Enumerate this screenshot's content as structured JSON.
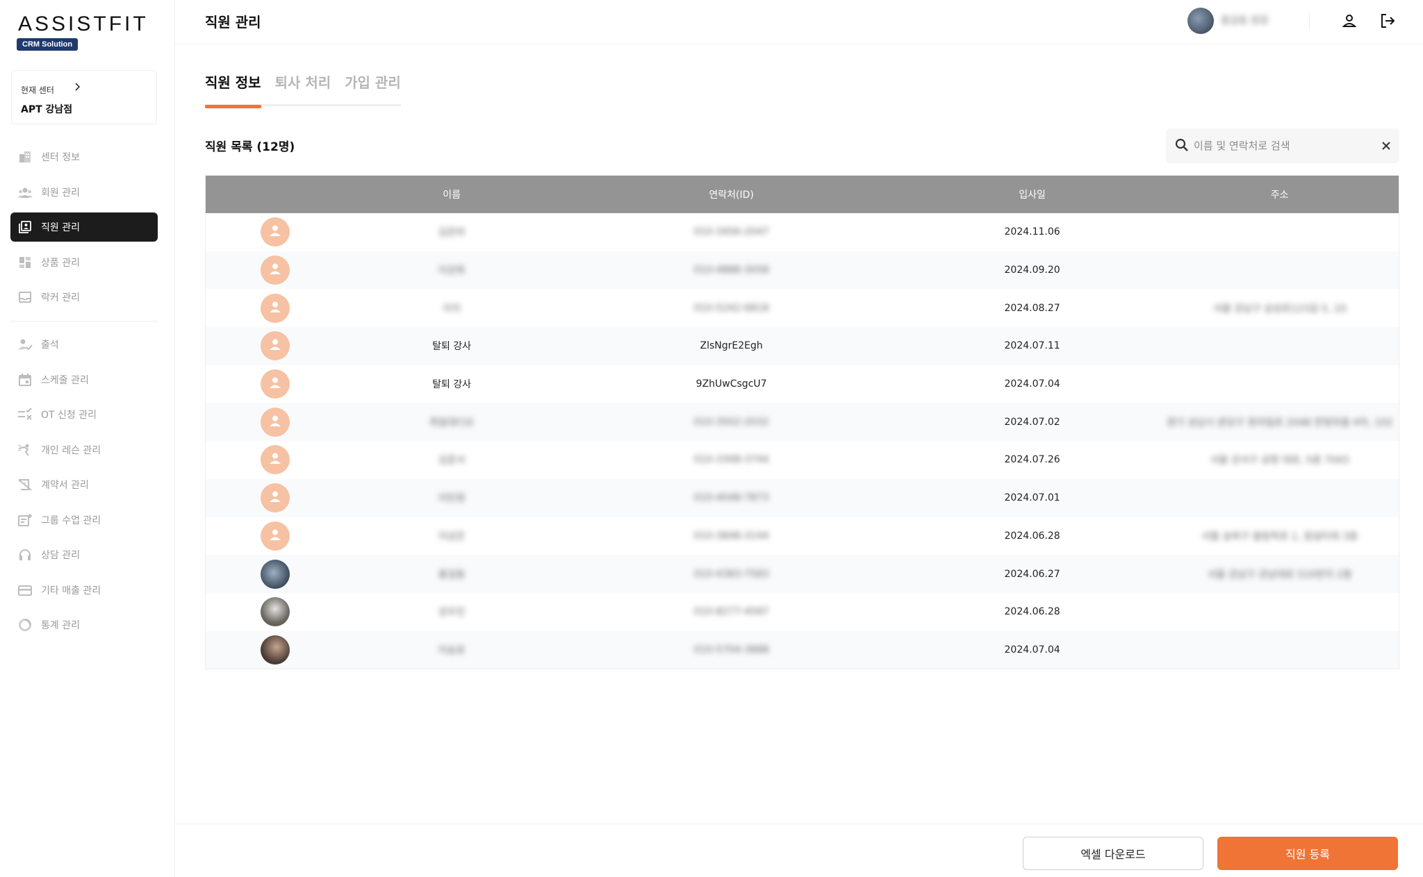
{
  "brand": {
    "logo": "ASSISTFIT",
    "badge": "CRM Solution"
  },
  "center": {
    "label": "현재 센터",
    "name": "APT 강남점"
  },
  "sidebar": {
    "items": [
      {
        "label": "센터 정보",
        "icon": "building-icon"
      },
      {
        "label": "회원 관리",
        "icon": "members-icon"
      },
      {
        "label": "직원 관리",
        "icon": "staff-icon",
        "active": true
      },
      {
        "label": "상품 관리",
        "icon": "grid-icon"
      },
      {
        "label": "락커 관리",
        "icon": "locker-icon"
      },
      {
        "label": "출석",
        "icon": "attendance-icon"
      },
      {
        "label": "스케줄 관리",
        "icon": "calendar-icon"
      },
      {
        "label": "OT 신청 관리",
        "icon": "ot-icon"
      },
      {
        "label": "개인 레슨 관리",
        "icon": "lesson-icon"
      },
      {
        "label": "계약서 관리",
        "icon": "contract-icon"
      },
      {
        "label": "그룹 수업 관리",
        "icon": "group-class-icon"
      },
      {
        "label": "상담 관리",
        "icon": "headset-icon"
      },
      {
        "label": "기타 매출 관리",
        "icon": "card-icon"
      },
      {
        "label": "통계 관리",
        "icon": "stats-icon"
      }
    ]
  },
  "header": {
    "title": "직원 관리",
    "user_name": "홍길동 원장"
  },
  "tabs": [
    {
      "label": "직원 정보",
      "active": true
    },
    {
      "label": "퇴사 처리"
    },
    {
      "label": "가입 관리"
    }
  ],
  "list": {
    "title": "직원 목록 (12명)"
  },
  "search": {
    "placeholder": "이름 및 연락처로 검색"
  },
  "table": {
    "columns": [
      "이름",
      "연락처(ID)",
      "입사일",
      "주소"
    ],
    "rows": [
      {
        "name": "김은비",
        "phone": "010-3456-2047",
        "date": "2024.11.06",
        "address": "",
        "avatar": "default",
        "blurred": true
      },
      {
        "name": "이강희",
        "phone": "010-4888-3058",
        "date": "2024.09.20",
        "address": "",
        "avatar": "default",
        "blurred": true
      },
      {
        "name": "이지",
        "phone": "010-5242-6818",
        "date": "2024.08.27",
        "address": "서울 강남구 삼성로123길 5, 10",
        "avatar": "default",
        "blurred": true
      },
      {
        "name": "탈퇴 강사",
        "phone": "ZlsNgrE2Egh",
        "date": "2024.07.11",
        "address": "",
        "avatar": "default",
        "blurred": false
      },
      {
        "name": "탈퇴 강사",
        "phone": "9ZhUwCsgcU7",
        "date": "2024.07.04",
        "address": "",
        "avatar": "default",
        "blurred": false
      },
      {
        "name": "최일대디오",
        "phone": "010-3502-2032",
        "date": "2024.07.02",
        "address": "경기 성남시 분당구 정자일로 2048 한빛마을 4차, 102",
        "avatar": "default",
        "blurred": true
      },
      {
        "name": "김준서",
        "phone": "010-3308-3744",
        "date": "2024.07.26",
        "address": "서울 강서구 공항 대로, 5층 7043",
        "avatar": "default",
        "blurred": true
      },
      {
        "name": "이민정",
        "phone": "010-4048-7873",
        "date": "2024.07.01",
        "address": "",
        "avatar": "default",
        "blurred": true
      },
      {
        "name": "이상은",
        "phone": "010-3848-3144",
        "date": "2024.06.28",
        "address": "서울 송파구 올림픽로 1, 잠실타워 3층",
        "avatar": "default",
        "blurred": true
      },
      {
        "name": "홍길동",
        "phone": "010-4383-7583",
        "date": "2024.06.27",
        "address": "서울 강남구 강남대로 510번지 2층",
        "avatar": "photo1",
        "blurred": true
      },
      {
        "name": "강우진",
        "phone": "010-8277-4587",
        "date": "2024.06.28",
        "address": "",
        "avatar": "photo2",
        "blurred": true
      },
      {
        "name": "이승호",
        "phone": "010-5704-3888",
        "date": "2024.07.04",
        "address": "",
        "avatar": "photo3",
        "blurred": true
      }
    ]
  },
  "footer": {
    "excel_label": "엑셀 다운로드",
    "register_label": "직원 등록"
  },
  "colors": {
    "accent": "#f07436",
    "active_menu": "#1c1c1c",
    "table_header": "#949494",
    "badge": "#1f3a6e"
  }
}
